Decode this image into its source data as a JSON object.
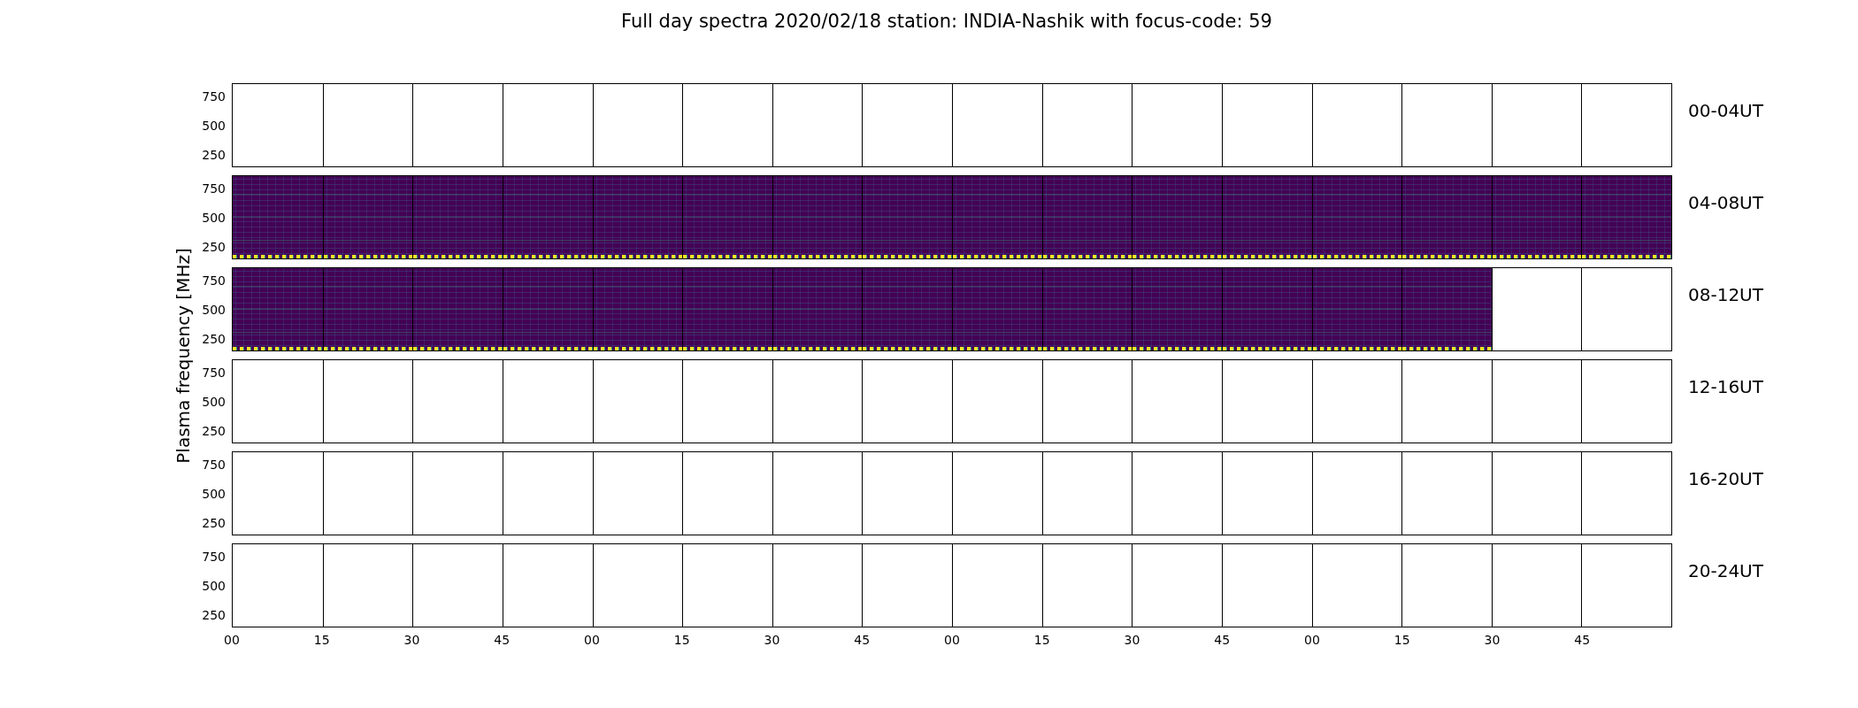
{
  "title": "Full day spectra 2020/02/18 station: INDIA-Nashik with focus-code: 59",
  "y_axis_label": "Plasma frequency [MHz]",
  "x_ticks": [
    "00",
    "15",
    "30",
    "45",
    "00",
    "15",
    "30",
    "45",
    "00",
    "15",
    "30",
    "45",
    "00",
    "15",
    "30",
    "45"
  ],
  "rows": [
    {
      "label": "00-04UT",
      "y_ticks": [
        "750",
        "500",
        "250"
      ],
      "panels": [
        {
          "has_data": false
        },
        {
          "has_data": false
        },
        {
          "has_data": false
        },
        {
          "has_data": false
        },
        {
          "has_data": false
        },
        {
          "has_data": false
        },
        {
          "has_data": false
        },
        {
          "has_data": false
        },
        {
          "has_data": false
        },
        {
          "has_data": false
        },
        {
          "has_data": false
        },
        {
          "has_data": false
        },
        {
          "has_data": false
        },
        {
          "has_data": false
        },
        {
          "has_data": false
        },
        {
          "has_data": false
        }
      ]
    },
    {
      "label": "04-08UT",
      "y_ticks": [
        "750",
        "500",
        "250"
      ],
      "panels": [
        {
          "has_data": true
        },
        {
          "has_data": true
        },
        {
          "has_data": true
        },
        {
          "has_data": true
        },
        {
          "has_data": true
        },
        {
          "has_data": true
        },
        {
          "has_data": true
        },
        {
          "has_data": true
        },
        {
          "has_data": true
        },
        {
          "has_data": true
        },
        {
          "has_data": true
        },
        {
          "has_data": true
        },
        {
          "has_data": true
        },
        {
          "has_data": true
        },
        {
          "has_data": true
        },
        {
          "has_data": true
        }
      ]
    },
    {
      "label": "08-12UT",
      "y_ticks": [
        "750",
        "500",
        "250"
      ],
      "panels": [
        {
          "has_data": true
        },
        {
          "has_data": true
        },
        {
          "has_data": true
        },
        {
          "has_data": true
        },
        {
          "has_data": true
        },
        {
          "has_data": true
        },
        {
          "has_data": true
        },
        {
          "has_data": true
        },
        {
          "has_data": true
        },
        {
          "has_data": true
        },
        {
          "has_data": true
        },
        {
          "has_data": true
        },
        {
          "has_data": true
        },
        {
          "has_data": true
        },
        {
          "has_data": false
        },
        {
          "has_data": false
        }
      ]
    },
    {
      "label": "12-16UT",
      "y_ticks": [
        "750",
        "500",
        "250"
      ],
      "panels": [
        {
          "has_data": false
        },
        {
          "has_data": false
        },
        {
          "has_data": false
        },
        {
          "has_data": false
        },
        {
          "has_data": false
        },
        {
          "has_data": false
        },
        {
          "has_data": false
        },
        {
          "has_data": false
        },
        {
          "has_data": false
        },
        {
          "has_data": false
        },
        {
          "has_data": false
        },
        {
          "has_data": false
        },
        {
          "has_data": false
        },
        {
          "has_data": false
        },
        {
          "has_data": false
        },
        {
          "has_data": false
        }
      ]
    },
    {
      "label": "16-20UT",
      "y_ticks": [
        "750",
        "500",
        "250"
      ],
      "panels": [
        {
          "has_data": false
        },
        {
          "has_data": false
        },
        {
          "has_data": false
        },
        {
          "has_data": false
        },
        {
          "has_data": false
        },
        {
          "has_data": false
        },
        {
          "has_data": false
        },
        {
          "has_data": false
        },
        {
          "has_data": false
        },
        {
          "has_data": false
        },
        {
          "has_data": false
        },
        {
          "has_data": false
        },
        {
          "has_data": false
        },
        {
          "has_data": false
        },
        {
          "has_data": false
        },
        {
          "has_data": false
        }
      ]
    },
    {
      "label": "20-24UT",
      "y_ticks": [
        "750",
        "500",
        "250"
      ],
      "panels": [
        {
          "has_data": false
        },
        {
          "has_data": false
        },
        {
          "has_data": false
        },
        {
          "has_data": false
        },
        {
          "has_data": false
        },
        {
          "has_data": false
        },
        {
          "has_data": false
        },
        {
          "has_data": false
        },
        {
          "has_data": false
        },
        {
          "has_data": false
        },
        {
          "has_data": false
        },
        {
          "has_data": false
        },
        {
          "has_data": false
        },
        {
          "has_data": false
        },
        {
          "has_data": false
        },
        {
          "has_data": false
        }
      ]
    }
  ]
}
